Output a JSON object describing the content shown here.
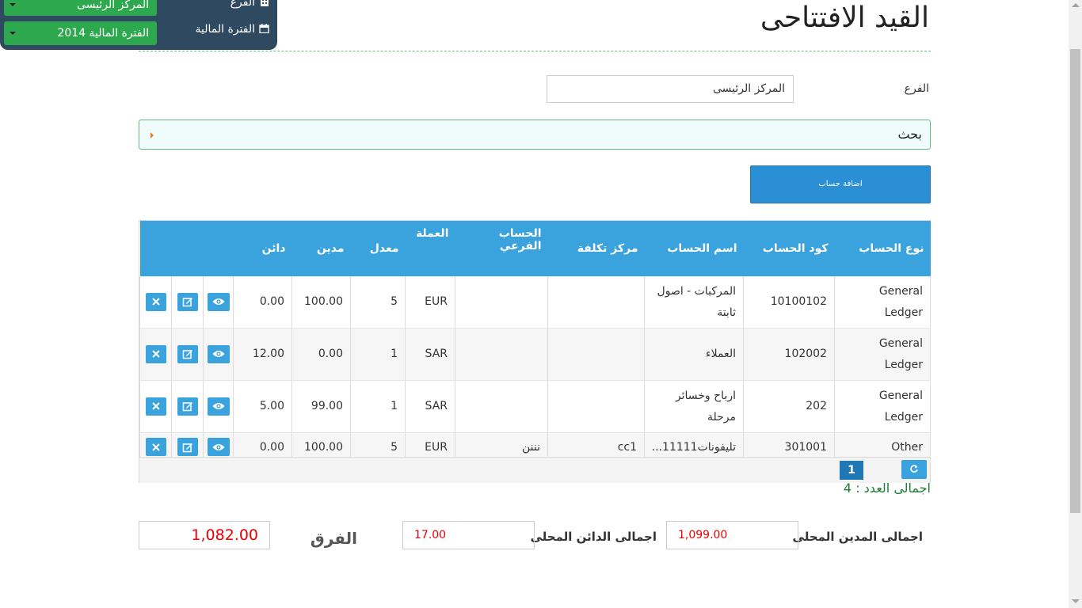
{
  "topbar": {
    "branch_label": "الفرع",
    "branch_value": "المركز الرئيسى",
    "period_label": "الفترة المالية",
    "period_value": "الفترة المالية 2014"
  },
  "page": {
    "title": "القيد الافتتاحى",
    "branch_label": "الفرع",
    "branch_value": "المركز الرئيسى",
    "search_label": "بحث",
    "add_account_label": "اضافة حساب"
  },
  "table": {
    "headers": [
      "نوع الحساب",
      "كود الحساب",
      "اسم الحساب",
      "مركز تكلفة",
      "الحساب الفرعي",
      "العملة",
      "معدل",
      "مدين",
      "دائن"
    ],
    "rows": [
      {
        "type": "General Ledger",
        "code": "10100102",
        "name": "المركبات - اصول ثابتة",
        "cost_center": "",
        "sub_account": "",
        "currency": "EUR",
        "rate": "5",
        "debit": "100.00",
        "credit": "0.00"
      },
      {
        "type": "General Ledger",
        "code": "102002",
        "name": "العملاء",
        "cost_center": "",
        "sub_account": "",
        "currency": "SAR",
        "rate": "1",
        "debit": "0.00",
        "credit": "12.00"
      },
      {
        "type": "General Ledger",
        "code": "202",
        "name": "ارباح وخسائر مرحلة",
        "cost_center": "",
        "sub_account": "",
        "currency": "SAR",
        "rate": "1",
        "debit": "99.00",
        "credit": "5.00"
      },
      {
        "type": "Other",
        "code": "301001",
        "name": "تليفونات11111...",
        "cost_center": "cc1",
        "sub_account": "نننن",
        "currency": "EUR",
        "rate": "5",
        "debit": "100.00",
        "credit": "0.00"
      }
    ],
    "page_number": "1"
  },
  "summary": {
    "total_count": "اجمالى العدد : 4",
    "local_debit_label": "اجمالى المدين المحلى",
    "local_debit_value": "1,099.00",
    "local_credit_label": "اجمالى الدائن المحلى",
    "local_credit_value": "17.00",
    "difference_label": "الفرق",
    "difference_value": "1,082.00"
  },
  "colors": {
    "header_blue": "#3aa3de",
    "topbar_bg": "#2f4a60",
    "select_green": "#2ea84f",
    "total_red": "#e00000"
  },
  "icons": [
    "building-icon",
    "calendar-icon",
    "eye-icon",
    "edit-icon",
    "delete-icon",
    "refresh-icon"
  ]
}
